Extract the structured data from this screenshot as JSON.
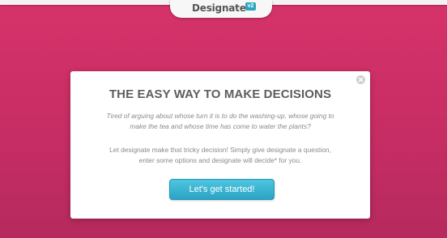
{
  "header": {
    "logo_text": "Designate",
    "logo_badge": "v2"
  },
  "modal": {
    "headline": "THE EASY WAY TO MAKE DECISIONS",
    "subtext_line1": "Tired of arguing about whose turn it is to do the washing-up, whose going to",
    "subtext_line2": "make the tea and whose time has come to water the plants?",
    "body_line1": "Let designate make that tricky decision! Simply give designate a question,",
    "body_line2": "enter some options and designate will decide* for you.",
    "cta_label": "Let's get started!"
  },
  "colors": {
    "background": "#c72d64",
    "accent_button": "#2aa3c4",
    "badge": "#2aa6bf"
  },
  "icons": {
    "close": "close-icon"
  }
}
